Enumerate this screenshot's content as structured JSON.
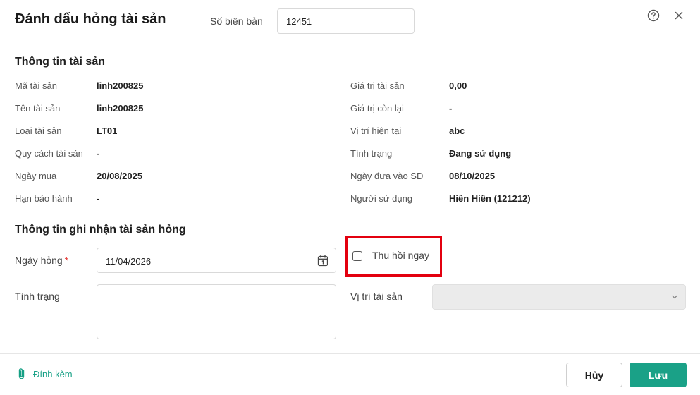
{
  "header": {
    "title": "Đánh dấu hỏng tài sản",
    "doc_number_label": "Số biên bản",
    "doc_number_value": "12451"
  },
  "asset_info": {
    "section_title": "Thông tin tài sản",
    "left": [
      {
        "label": "Mã tài sản",
        "value": "linh200825"
      },
      {
        "label": "Tên tài sản",
        "value": "linh200825"
      },
      {
        "label": "Loại tài sản",
        "value": "LT01"
      },
      {
        "label": "Quy cách tài sản",
        "value": "-"
      },
      {
        "label": "Ngày mua",
        "value": "20/08/2025"
      },
      {
        "label": "Hạn bảo hành",
        "value": "-"
      }
    ],
    "right": [
      {
        "label": "Giá trị tài sản",
        "value": "0,00"
      },
      {
        "label": "Giá trị còn lại",
        "value": "-"
      },
      {
        "label": "Vị trí hiện tại",
        "value": "abc"
      },
      {
        "label": "Tình trạng",
        "value": "Đang sử dụng"
      },
      {
        "label": "Ngày đưa vào SD",
        "value": "08/10/2025"
      },
      {
        "label": "Người sử dụng",
        "value": "Hiền Hiền (121212)"
      }
    ]
  },
  "damage_info": {
    "section_title": "Thông tin ghi nhận tài sản hỏng",
    "damage_date_label": "Ngày hỏng",
    "required_mark": "*",
    "damage_date_value": "11/04/2026",
    "recall_label": "Thu hồi ngay",
    "recall_checked": false,
    "status_label": "Tình trạng",
    "status_value": "",
    "location_label": "Vị trí tài sản",
    "location_value": ""
  },
  "footer": {
    "attach_label": "Đính kèm",
    "cancel_label": "Hủy",
    "save_label": "Lưu"
  },
  "colors": {
    "primary": "#1aa187",
    "attach_text": "#16a085",
    "highlight_border": "#e3000f",
    "required": "#e53935"
  },
  "icons": [
    "help-icon",
    "close-icon",
    "calendar-icon",
    "chevron-down-icon",
    "paperclip-icon"
  ]
}
